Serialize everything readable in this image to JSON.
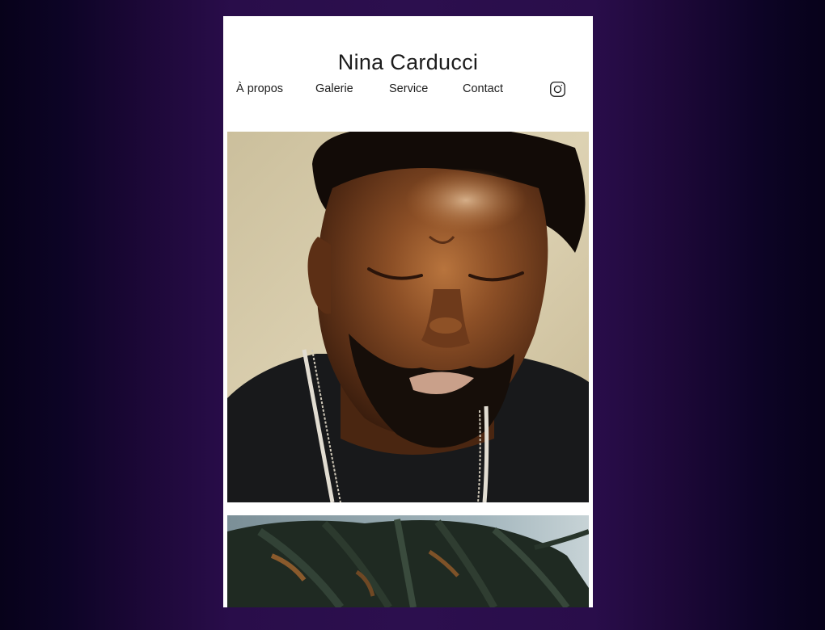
{
  "site": {
    "title": "Nina Carducci"
  },
  "nav": {
    "items": [
      {
        "label": "À propos"
      },
      {
        "label": "Galerie"
      },
      {
        "label": "Service"
      },
      {
        "label": "Contact"
      }
    ],
    "social_icon": "instagram-icon"
  },
  "gallery": {
    "images": [
      {
        "subject": "portrait",
        "alt": ""
      },
      {
        "subject": "palm-trees",
        "alt": ""
      }
    ]
  },
  "colors": {
    "page_background": "#2a0d4b",
    "page_edge": "#07021a",
    "card_background": "#ffffff",
    "text": "#1c1c1c"
  }
}
